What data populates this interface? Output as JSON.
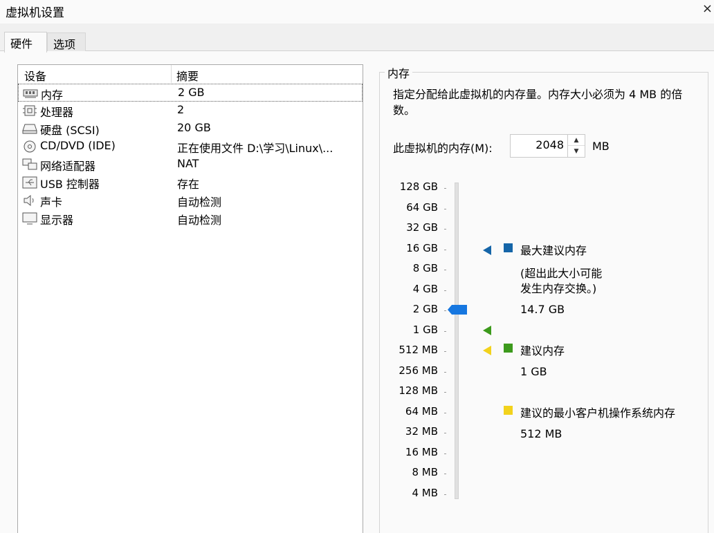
{
  "window": {
    "title": "虚拟机设置",
    "close_glyph": "×"
  },
  "tabs": [
    {
      "label": "硬件"
    },
    {
      "label": "选项"
    }
  ],
  "device_list": {
    "headers": {
      "device": "设备",
      "summary": "摘要"
    },
    "rows": [
      {
        "name": "内存",
        "summary": "2 GB",
        "icon": "memory-icon"
      },
      {
        "name": "处理器",
        "summary": "2",
        "icon": "processor-icon"
      },
      {
        "name": "硬盘 (SCSI)",
        "summary": "20 GB",
        "icon": "hard-disk-icon"
      },
      {
        "name": "CD/DVD (IDE)",
        "summary": "正在使用文件 D:\\学习\\Linux\\...",
        "icon": "cd-dvd-icon"
      },
      {
        "name": "网络适配器",
        "summary": "NAT",
        "icon": "network-adapter-icon"
      },
      {
        "name": "USB 控制器",
        "summary": "存在",
        "icon": "usb-icon"
      },
      {
        "name": "声卡",
        "summary": "自动检测",
        "icon": "speaker-icon"
      },
      {
        "name": "显示器",
        "summary": "自动检测",
        "icon": "monitor-icon"
      }
    ]
  },
  "memory_panel": {
    "group_title": "内存",
    "description": "指定分配给此虚拟机的内存量。内存大小必须为 4 MB 的倍数。",
    "memory_label": "此虚拟机的内存(M):",
    "memory_value": "2048",
    "unit": "MB",
    "scale_labels": [
      "128 GB",
      "64 GB",
      "32 GB",
      "16 GB",
      "8 GB",
      "4 GB",
      "2 GB",
      "1 GB",
      "512 MB",
      "256 MB",
      "128 MB",
      "64 MB",
      "32 MB",
      "16 MB",
      "8 MB",
      "4 MB"
    ],
    "slider_value": "2 GB",
    "legend": {
      "max": {
        "title": "最大建议内存",
        "note_line1": "(超出此大小可能",
        "note_line2": "发生内存交换。)",
        "value": "14.7 GB"
      },
      "recommended": {
        "title": "建议内存",
        "value": "1 GB"
      },
      "minimum": {
        "title": "建议的最小客户机操作系统内存",
        "value": "512 MB"
      }
    },
    "colors": {
      "max": "#1565a8",
      "recommended": "#3c9a1c",
      "minimum": "#f2d21c",
      "thumb": "#1677e0"
    }
  }
}
